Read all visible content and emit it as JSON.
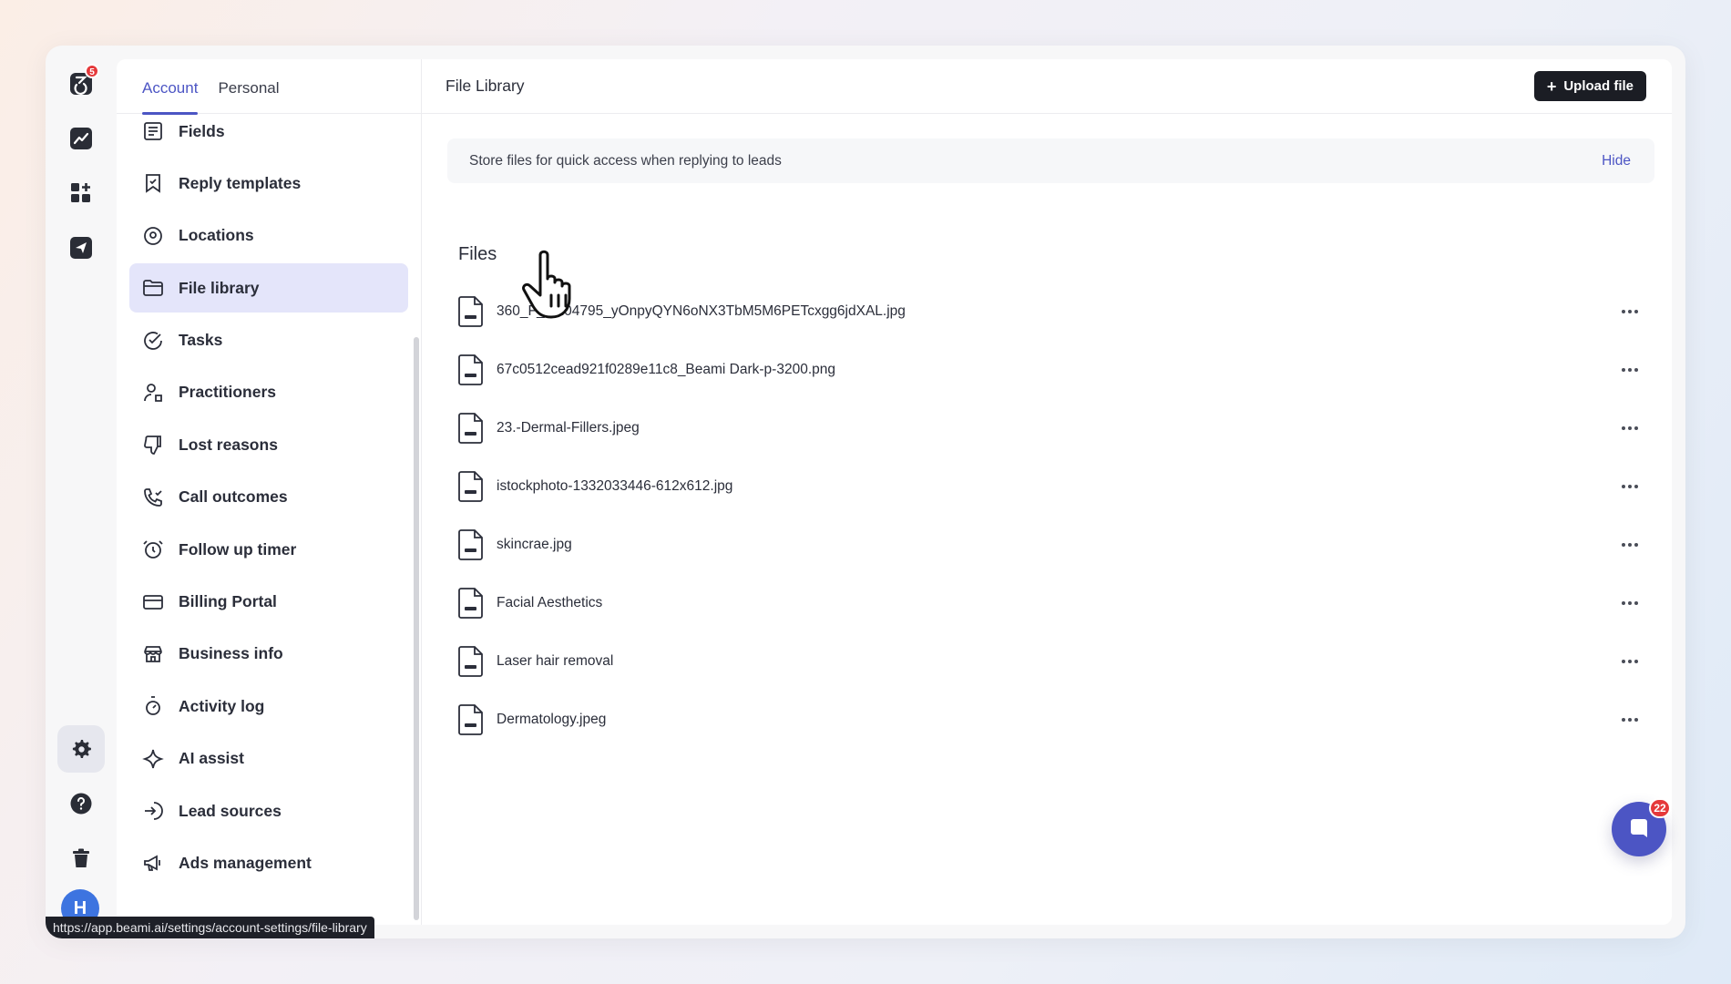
{
  "rail": {
    "logo_badge": "5",
    "avatar_initial": "H",
    "items": [
      {
        "icon": "logo-icon"
      },
      {
        "icon": "analytics-icon"
      },
      {
        "icon": "apps-icon"
      },
      {
        "icon": "send-icon"
      },
      {
        "icon": "gear-icon"
      },
      {
        "icon": "help-icon"
      },
      {
        "icon": "trash-icon"
      }
    ]
  },
  "settings": {
    "tabs": [
      {
        "label": "Account",
        "active": true
      },
      {
        "label": "Personal",
        "active": false
      }
    ],
    "menu": [
      {
        "label": "Fields",
        "icon": "fields-icon"
      },
      {
        "label": "Reply templates",
        "icon": "bookmark-icon"
      },
      {
        "label": "Locations",
        "icon": "location-pin-icon"
      },
      {
        "label": "File library",
        "icon": "folder-icon",
        "active": true
      },
      {
        "label": "Tasks",
        "icon": "check-circle-icon"
      },
      {
        "label": "Practitioners",
        "icon": "user-icon"
      },
      {
        "label": "Lost reasons",
        "icon": "thumbs-down-icon"
      },
      {
        "label": "Call outcomes",
        "icon": "phone-icon"
      },
      {
        "label": "Follow up timer",
        "icon": "alarm-icon"
      },
      {
        "label": "Billing Portal",
        "icon": "credit-card-icon"
      },
      {
        "label": "Business info",
        "icon": "store-icon"
      },
      {
        "label": "Activity log",
        "icon": "stopwatch-icon"
      },
      {
        "label": "AI assist",
        "icon": "sparkle-icon"
      },
      {
        "label": "Lead sources",
        "icon": "sign-in-icon"
      },
      {
        "label": "Ads management",
        "icon": "megaphone-icon"
      }
    ]
  },
  "main": {
    "title": "File Library",
    "upload_label": "Upload file",
    "banner_text": "Store files for quick access when replying to leads",
    "banner_hide": "Hide",
    "section_title": "Files",
    "files": [
      "360_F_...204795_yOnpyQYN6oNX3TbM5M6PETcxgg6jdXAL.jpg",
      "67c0512cead921f0289e11c8_Beami Dark-p-3200.png",
      "23.-Dermal-Fillers.jpeg",
      "istockphoto-1332033446-612x612.jpg",
      "skincrae.jpg",
      "Facial Aesthetics",
      "Laser hair removal",
      "Dermatology.jpeg"
    ]
  },
  "chat": {
    "badge": "22"
  },
  "status_url": "https://app.beami.ai/settings/account-settings/file-library",
  "colors": {
    "accent": "#4c55c4",
    "active_bg": "#e4e5fa",
    "dark_button": "#1b1d24",
    "badge_red": "#e5393b"
  }
}
